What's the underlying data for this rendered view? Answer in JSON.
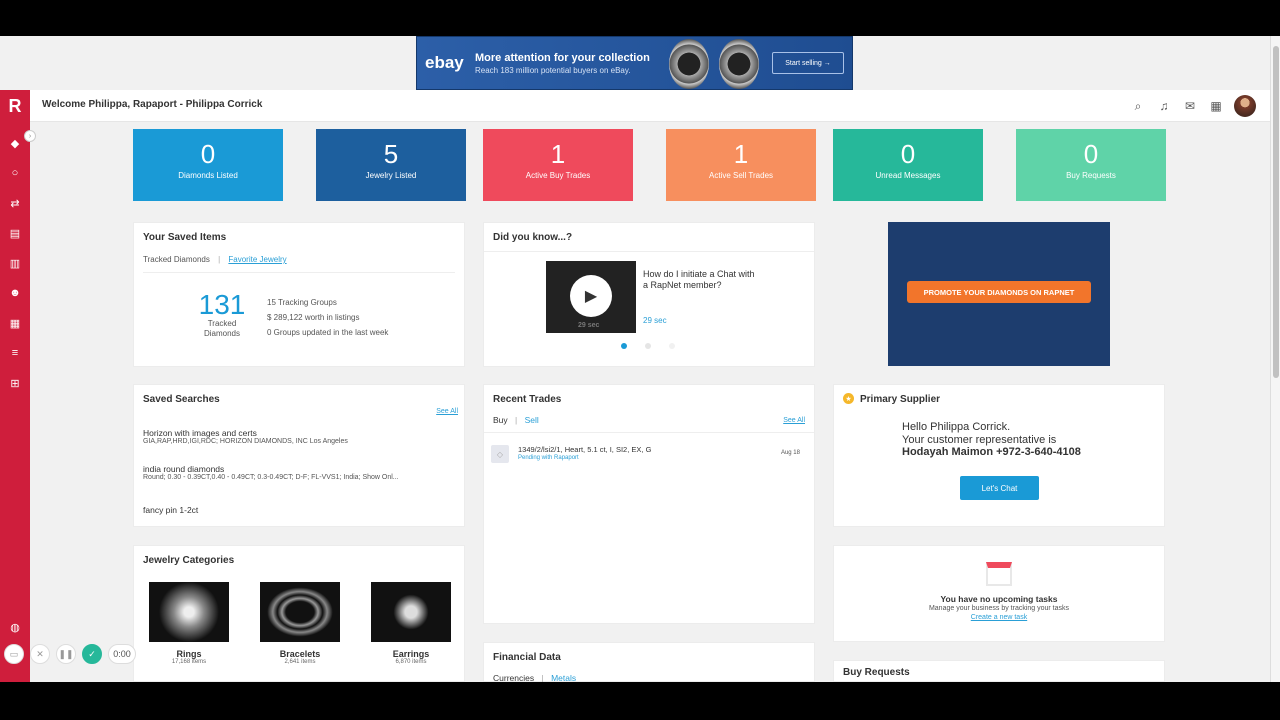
{
  "banner": {
    "brand": "ebay",
    "headline": "More attention for your collection",
    "subline": "Reach 183 million potential buyers on eBay.",
    "cta": "Start selling →"
  },
  "header": {
    "welcome": "Welcome Philippa, Rapaport - Philippa Corrick",
    "icons": [
      "search-icon",
      "bell-icon",
      "chat-icon",
      "calculator-icon"
    ]
  },
  "sidebar": {
    "logo": "R",
    "icons": [
      "diamond-icon",
      "ring-icon",
      "handshake-icon",
      "clipboard-icon",
      "chart-icon",
      "people-icon",
      "store-icon",
      "list-icon",
      "grid-icon",
      "flag-icon",
      "help-icon"
    ]
  },
  "stats": [
    {
      "value": "0",
      "label": "Diamonds Listed",
      "color": "#1a9ad6"
    },
    {
      "value": "5",
      "label": "Jewelry Listed",
      "color": "#1d5f9e"
    },
    {
      "value": "1",
      "label": "Active Buy Trades",
      "color": "#ef4a5c"
    },
    {
      "value": "1",
      "label": "Active Sell Trades",
      "color": "#f78f5e"
    },
    {
      "value": "0",
      "label": "Unread Messages",
      "color": "#26b89a"
    },
    {
      "value": "0",
      "label": "Buy Requests",
      "color": "#5fd3a8"
    }
  ],
  "saved_items": {
    "title": "Your Saved Items",
    "tab1": "Tracked Diamonds",
    "tab2": "Favorite Jewelry",
    "count": "131",
    "count_label": "Tracked Diamonds",
    "line1": "15 Tracking Groups",
    "line2": "$ 289,122 worth in listings",
    "line3": "0 Groups updated in the last week"
  },
  "did_you_know": {
    "title": "Did you know...?",
    "video_time": "29 sec",
    "question": "How do I initiate a Chat with a RapNet member?",
    "duration": "29 sec"
  },
  "promo": {
    "button": "PROMOTE YOUR DIAMONDS ON RAPNET"
  },
  "saved_searches": {
    "title": "Saved Searches",
    "see_all": "See All",
    "items": [
      {
        "name": "Horizon with images and certs",
        "detail": "GIA,RAP,HRD,IGI,RDC; HORIZON DIAMONDS, INC Los Angeles"
      },
      {
        "name": "india round diamonds",
        "detail": "Round; 0.30 - 0.39CT,0.40 - 0.49CT; 0.3-0.49CT; D-F; FL-VVS1; India; Show Onl..."
      },
      {
        "name": "fancy pin 1-2ct",
        "detail": ""
      }
    ]
  },
  "recent_trades": {
    "title": "Recent Trades",
    "tab_buy": "Buy",
    "tab_sell": "Sell",
    "see_all": "See All",
    "trade": {
      "desc": "1349/2/lsi2/1, Heart, 5.1 ct, I, SI2, EX, G",
      "status": "Pending with Rapaport",
      "date": "Aug 18"
    }
  },
  "primary_supplier": {
    "title": "Primary Supplier",
    "line1": "Hello Philippa Corrick.",
    "line2": "Your customer representative is",
    "line3": "Hodayah Maimon +972-3-640-4108",
    "button": "Let's Chat"
  },
  "jewelry_categories": {
    "title": "Jewelry Categories",
    "items": [
      {
        "name": "Rings",
        "count": "17,168 items"
      },
      {
        "name": "Bracelets",
        "count": "2,641 items"
      },
      {
        "name": "Earrings",
        "count": "6,870 items"
      }
    ]
  },
  "tasks": {
    "title": "You have no upcoming tasks",
    "sub": "Manage your business by tracking your tasks",
    "link": "Create a new task"
  },
  "financial": {
    "title": "Financial Data",
    "tab1": "Currencies",
    "tab2": "Metals"
  },
  "buy_requests": {
    "title": "Buy Requests"
  },
  "recorder": {
    "time": "0:00"
  }
}
